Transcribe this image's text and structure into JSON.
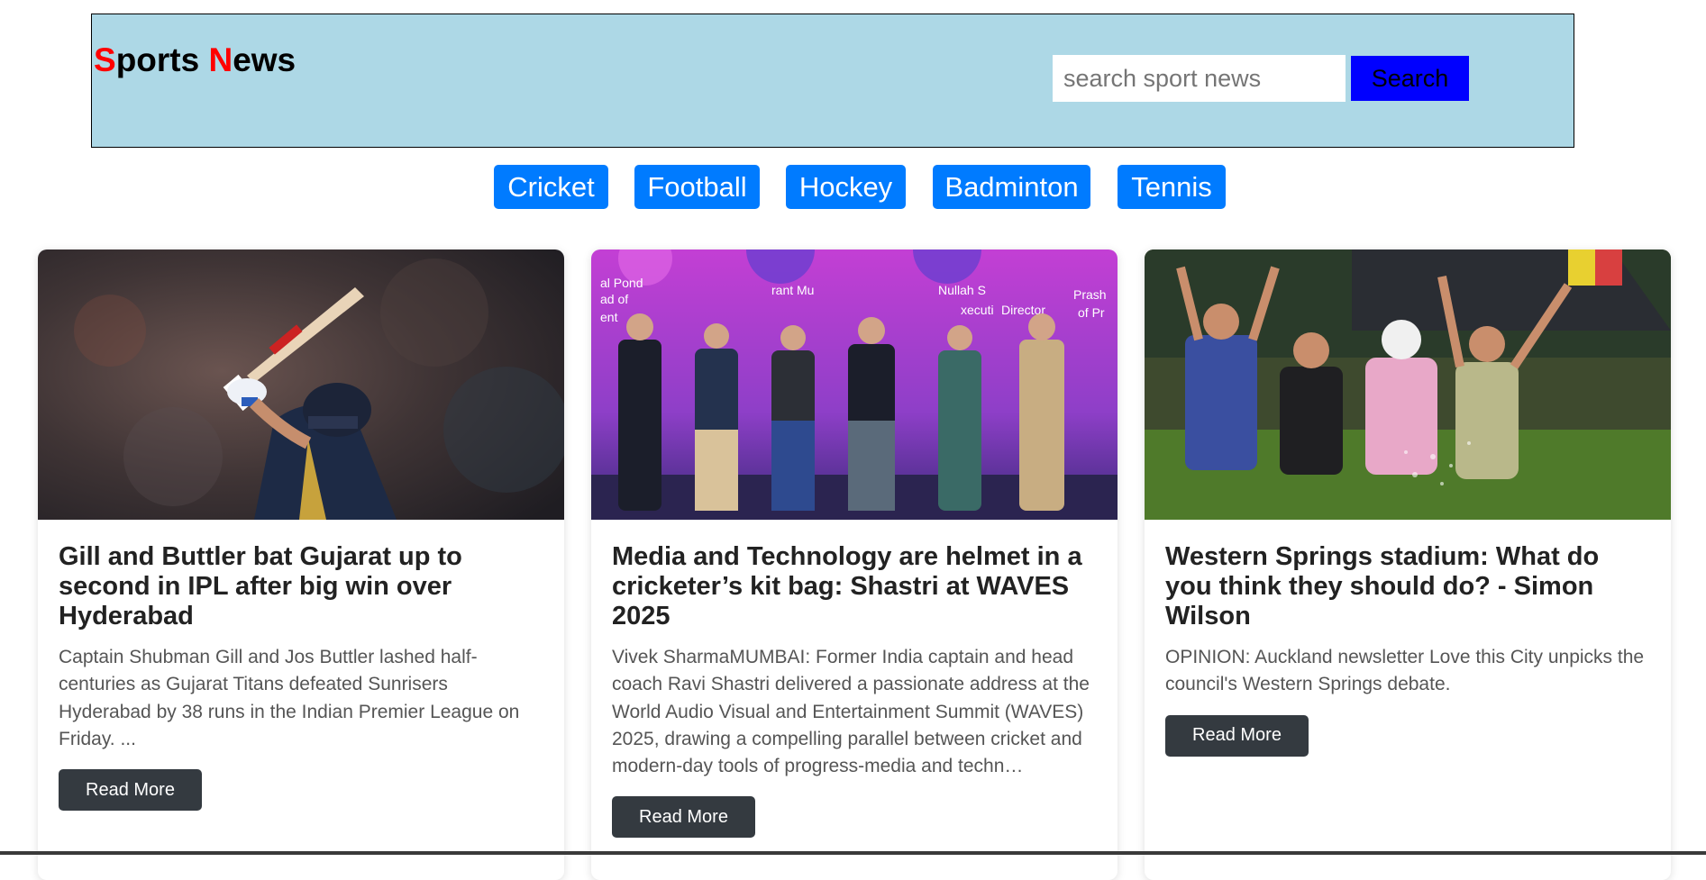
{
  "header": {
    "logo_initial_1": "S",
    "logo_rest_1": "ports ",
    "logo_initial_2": "N",
    "logo_rest_2": "ews",
    "search_placeholder": "search sport news",
    "search_value": "",
    "search_button": "Search"
  },
  "nav": {
    "items": [
      {
        "label": "Cricket"
      },
      {
        "label": "Football"
      },
      {
        "label": "Hockey"
      },
      {
        "label": "Badminton"
      },
      {
        "label": "Tennis"
      }
    ]
  },
  "articles": [
    {
      "title": "Gill and Buttler bat Gujarat up to second in IPL after big win over Hyderabad",
      "description": "Captain Shubman Gill and Jos Buttler lashed half-centuries as Gujarat Titans defeated Sunrisers Hyderabad by 38 runs in the Indian Premier League on Friday. ...",
      "button": "Read More",
      "image_alt": "cricket-batsman-photo"
    },
    {
      "title": "Media and Technology are helmet in a cricketer’s kit bag: Shastri at WAVES 2025",
      "description": "Vivek SharmaMUMBAI: Former India captain and head coach Ravi Shastri delivered a passionate address at the World Audio Visual and Entertainment Summit (WAVES) 2025, drawing a compelling parallel between cricket and modern-day tools of progress-media and techn…",
      "button": "Read More",
      "image_alt": "panel-stage-photo",
      "image_sign_words": [
        "al Pond",
        "ad of",
        "ent",
        "rant Mu",
        "Nullah S",
        "xecuti",
        "Director",
        "Prash",
        "of Pr"
      ]
    },
    {
      "title": "Western Springs stadium: What do you think they should do? - Simon Wilson",
      "description": "OPINION: Auckland newsletter Love this City unpicks the council's Western Springs debate.",
      "button": "Read More",
      "image_alt": "festival-crowd-rain-photo"
    }
  ],
  "colors": {
    "header_bg": "#add8e6",
    "logo_accent": "#ff0000",
    "search_button_bg": "#0000ff",
    "nav_button_bg": "#007bff",
    "read_more_bg": "#343a40"
  }
}
